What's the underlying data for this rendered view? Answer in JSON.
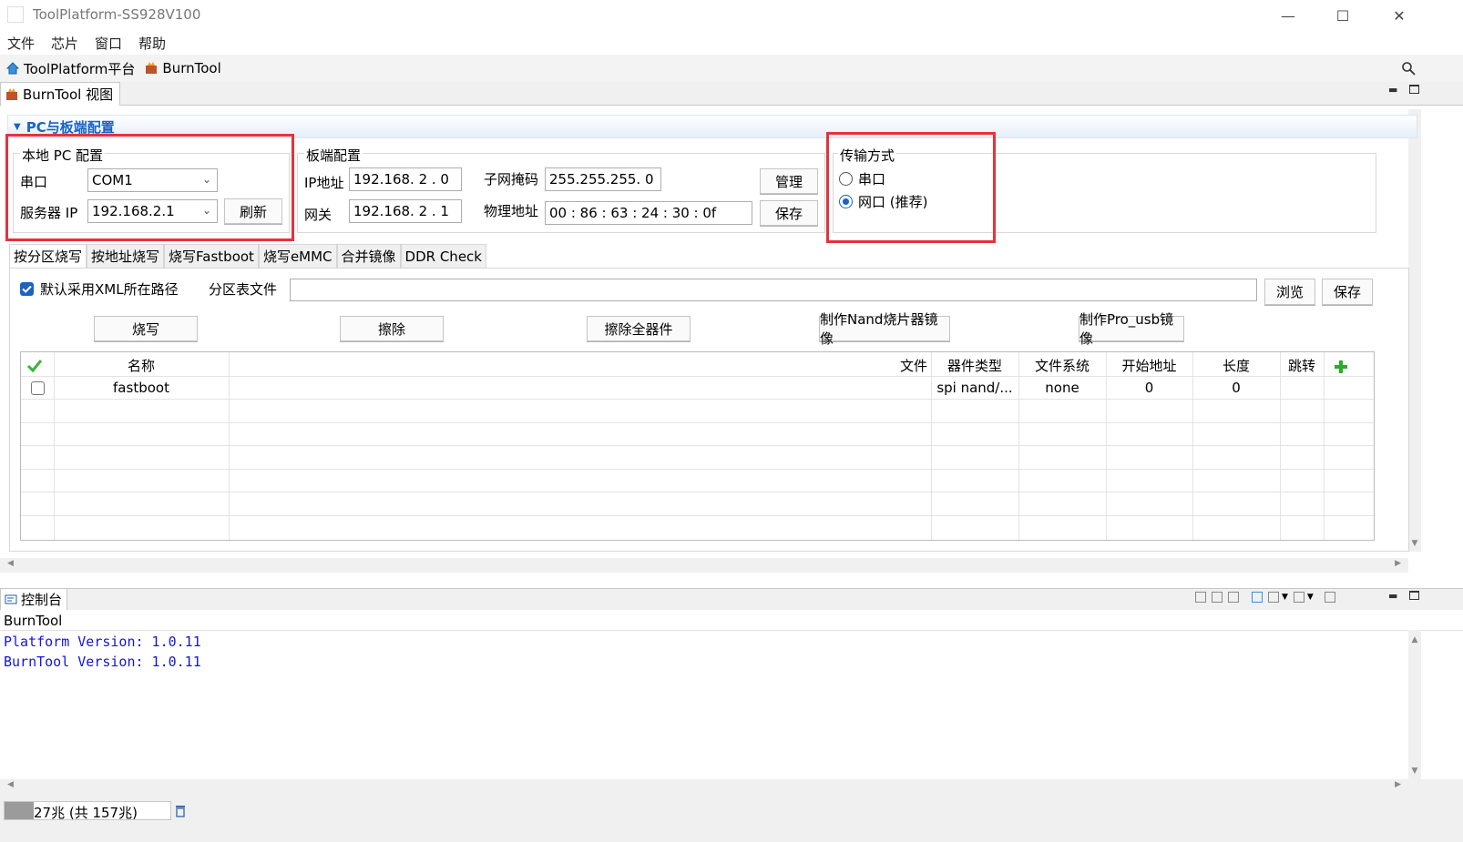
{
  "window": {
    "title": "ToolPlatform-SS928V100"
  },
  "menu": [
    "文件",
    "芯片",
    "窗口",
    "帮助"
  ],
  "toolbar": {
    "platform_label": "ToolPlatform平台",
    "burntool_label": "BurnTool"
  },
  "view_tab": {
    "label": "BurnTool 视图"
  },
  "section": {
    "title": "PC与板端配置"
  },
  "local_pc": {
    "title": "本地 PC 配置",
    "serial_label": "串口",
    "serial_value": "COM1",
    "server_ip_label": "服务器 IP",
    "server_ip_value": "192.168.2.1",
    "refresh_label": "刷新"
  },
  "board": {
    "title": "板端配置",
    "ip_label": "IP地址",
    "ip_value": "192.168. 2 . 0",
    "gateway_label": "网关",
    "gateway_value": "192.168. 2 . 1",
    "subnet_label": "子网掩码",
    "subnet_value": "255.255.255. 0",
    "mac_label": "物理地址",
    "mac_value": "00 : 86 : 63 : 24 : 30 : 0f",
    "manage_label": "管理",
    "save_label": "保存"
  },
  "transfer": {
    "title": "传输方式",
    "serial_option": "串口",
    "network_option": "网口 (推荐)",
    "selected": "network"
  },
  "burn_tabs": [
    "按分区烧写",
    "按地址烧写",
    "烧写Fastboot",
    "烧写eMMC",
    "合并镜像",
    "DDR Check"
  ],
  "partition": {
    "use_xml_path_label": "默认采用XML所在路径",
    "use_xml_path_checked": true,
    "table_file_label": "分区表文件",
    "table_file_value": "",
    "browse_label": "浏览",
    "save_label": "保存"
  },
  "actions": [
    "烧写",
    "擦除",
    "擦除全器件",
    "制作Nand烧片器镜像",
    "制作Pro_usb镜像"
  ],
  "table": {
    "columns": [
      "名称",
      "文件",
      "器件类型",
      "文件系统",
      "开始地址",
      "长度",
      "跳转"
    ],
    "rows": [
      {
        "name": "fastboot",
        "file": "",
        "device": "spi nand/...",
        "fs": "none",
        "start": "0",
        "length": "0",
        "jump": "",
        "checked": false
      }
    ]
  },
  "console": {
    "tab_label": "控制台",
    "header": "BurnTool",
    "lines": [
      "Platform Version: 1.0.11",
      "BurnTool Version: 1.0.11"
    ]
  },
  "status": {
    "memory": "27兆 (共 157兆)"
  },
  "colors": {
    "accent": "#1a63c5",
    "highlight_box": "#e5333b",
    "console_text": "#1515d8"
  }
}
